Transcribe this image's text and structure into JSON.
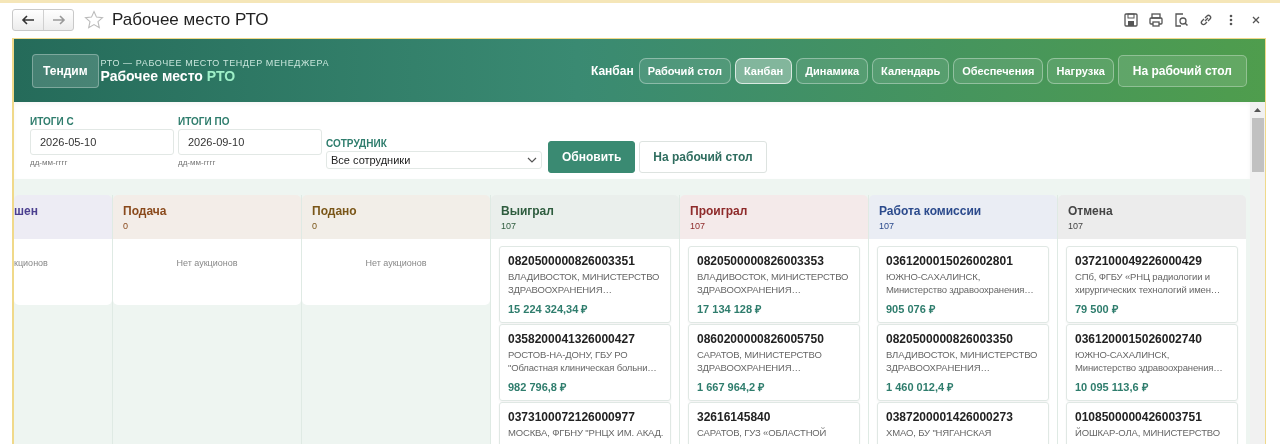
{
  "window": {
    "title": "Рабочее место РТО"
  },
  "header": {
    "logo": "Тендим",
    "subtitle": "РТО — РАБОЧЕЕ МЕСТО ТЕНДЕР МЕНЕДЖЕРА",
    "title": "Рабочее место",
    "title_accent": "РТО",
    "current_view": "Канбан",
    "home_button": "На рабочий стол"
  },
  "tabs": [
    {
      "label": "Рабочий стол",
      "selected": false
    },
    {
      "label": "Канбан",
      "selected": true
    },
    {
      "label": "Динамика",
      "selected": false
    },
    {
      "label": "Календарь",
      "selected": false
    },
    {
      "label": "Обеспечения",
      "selected": false
    },
    {
      "label": "Нагрузка",
      "selected": false
    }
  ],
  "filters": {
    "date_from": {
      "label": "ИТОГИ С",
      "value": "2026-05-10",
      "hint": "дд-мм-гггг"
    },
    "date_to": {
      "label": "ИТОГИ ПО",
      "value": "2026-09-10",
      "hint": "дд-мм-гггг"
    },
    "employee": {
      "label": "СОТРУДНИК",
      "value": "Все сотрудники"
    },
    "buttons": [
      {
        "label": "Обновить",
        "kind": "primary"
      },
      {
        "label": "На рабочий стол",
        "kind": "secondary"
      }
    ]
  },
  "columns": [
    {
      "title": "шен",
      "color": "#4b3f8f",
      "empty_text": "кционов"
    },
    {
      "title": "Подача",
      "count": "0",
      "color": "#8a4a1c",
      "empty_text": "Нет аукционов"
    },
    {
      "title": "Подано",
      "count": "0",
      "color": "#7a5618",
      "empty_text": "Нет аукционов"
    },
    {
      "title": "Выиграл",
      "count": "107",
      "color": "#2e5c3e",
      "cards": [
        {
          "number": "0820500000826003351",
          "customer": "ВЛАДИВОСТОК, МИНИСТЕРСТВО ЗДРАВООХРАНЕНИЯ…",
          "amount": "15 224 324,34 ₽"
        },
        {
          "number": "0358200041326000427",
          "customer": "РОСТОВ-НА-ДОНУ, ГБУ РО \"Областная клиническая больни…",
          "amount": "982 796,8 ₽"
        },
        {
          "number": "0373100072126000977",
          "customer": "МОСКВА, ФГБНУ \"РНЦХ ИМ. АКАД."
        }
      ]
    },
    {
      "title": "Проиграл",
      "count": "107",
      "color": "#8e2a2a",
      "cards": [
        {
          "number": "0820500000826003353",
          "customer": "ВЛАДИВОСТОК, МИНИСТЕРСТВО ЗДРАВООХРАНЕНИЯ…",
          "amount": "17 134 128 ₽"
        },
        {
          "number": "0860200000826005750",
          "customer": "САРАТОВ, МИНИСТЕРСТВО ЗДРАВООХРАНЕНИЯ…",
          "amount": "1 667 964,2 ₽"
        },
        {
          "number": "32616145840",
          "customer": "САРАТОВ, ГУЗ «ОБЛАСТНОЙ"
        }
      ]
    },
    {
      "title": "Работа комиссии",
      "count": "107",
      "color": "#2b4a8c",
      "cards": [
        {
          "number": "0361200015026002801",
          "customer": "ЮЖНО-САХАЛИНСК, Министерство здравоохранения…",
          "amount": "905 076 ₽"
        },
        {
          "number": "0820500000826003350",
          "customer": "ВЛАДИВОСТОК, МИНИСТЕРСТВО ЗДРАВООХРАНЕНИЯ…",
          "amount": "1 460 012,4 ₽"
        },
        {
          "number": "0387200001426000273",
          "customer": "ХМАО, БУ \"НЯГАНСКАЯ"
        }
      ]
    },
    {
      "title": "Отмена",
      "count": "107",
      "color": "#454545",
      "cards": [
        {
          "number": "0372100049226000429",
          "customer": "СПб, ФГБУ «РНЦ радиологии и хирургических технологий имен…",
          "amount": "79 500 ₽"
        },
        {
          "number": "0361200015026002740",
          "customer": "ЮЖНО-САХАЛИНСК, Министерство здравоохранения…",
          "amount": "10 095 113,6 ₽"
        },
        {
          "number": "0108500000426003751",
          "customer": "ЙОШКАР-ОЛА, МИНИСТЕРСТВО"
        }
      ]
    }
  ]
}
